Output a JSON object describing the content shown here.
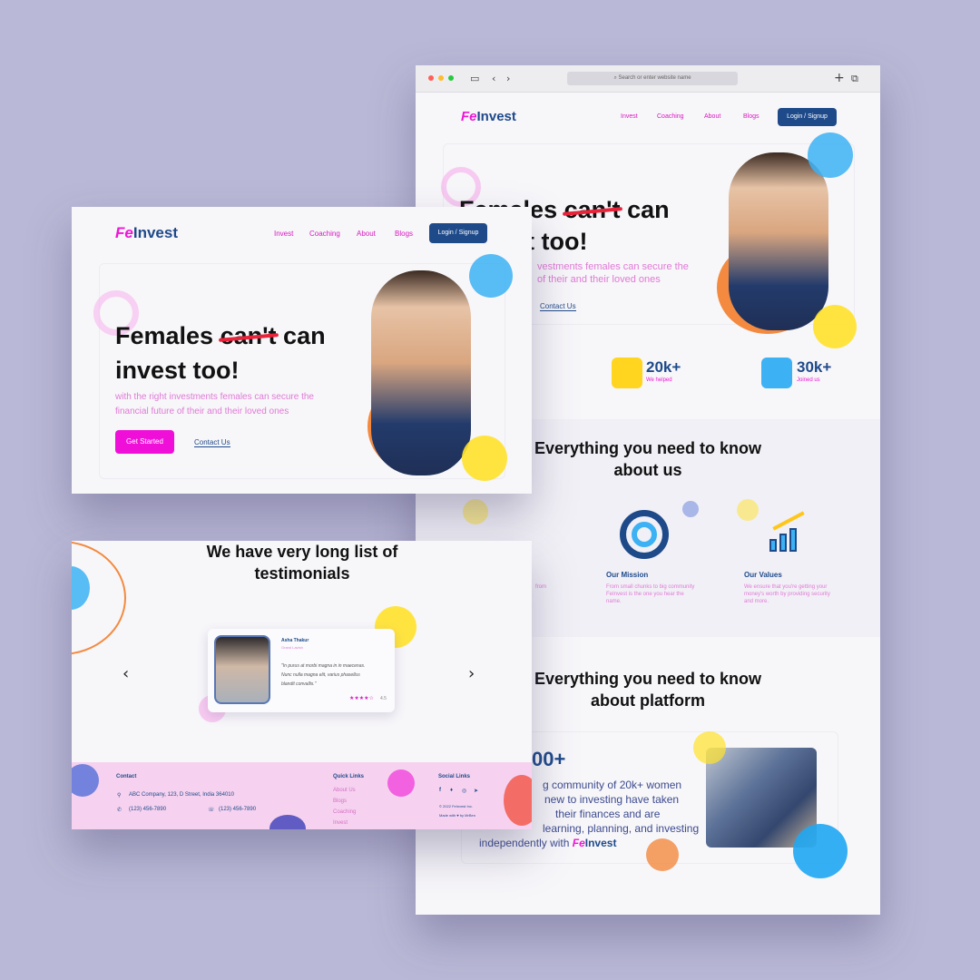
{
  "brand": {
    "fe": "Fe",
    "invest": "Invest"
  },
  "nav": {
    "invest": "Invest",
    "coaching": "Coaching",
    "about": "About",
    "blogs": "Blogs",
    "login": "Login / Signup"
  },
  "browser": {
    "url_placeholder": "Search or enter website name"
  },
  "hero": {
    "title_word1": "Females",
    "title_strike": "can't",
    "title_word3": "can",
    "title_line2": "invest too!",
    "subtitle_line1": "with the right investments females can secure the",
    "subtitle_line2": "financial future of their and their loved ones",
    "cta_primary": "Get Started",
    "cta_secondary": "Contact Us"
  },
  "browser_hero": {
    "title_line1_a": "Fema",
    "title_line1_b": "les",
    "title_strike": "can't",
    "title_word3": "can",
    "title_line2": "t too!",
    "subtitle_line1": "vestments females can secure the",
    "subtitle_line2": "of their and their loved ones"
  },
  "stats": [
    {
      "value": "20k+",
      "label": "We helped"
    },
    {
      "value": "30k+",
      "label": "Joined us"
    }
  ],
  "about": {
    "title_line1": "Everything you need to know",
    "title_line2": "about us",
    "mission_title": "Our Mission",
    "mission_text": "From small chunks to big community FeInvest is the one you hear the name.",
    "values_title": "Our Values",
    "values_text": "We ensure that you're getting your money's worth by providing security and more.",
    "left_text_fragment": "from"
  },
  "platform": {
    "title_line1": "Everything you need to know",
    "title_line2": "about platform",
    "count": "00+",
    "text_line1": "g community of 20k+ women",
    "text_line2": "new to investing have taken",
    "text_line3": "their finances and are",
    "text_line4": "learning, planning, and investing",
    "text_line5": "independently with"
  },
  "testimonials": {
    "title_line1": "We have very long list of",
    "title_line2": "testimonials",
    "name": "Asha Thakur",
    "role": "Grand Lavish",
    "quote_line1": "\"In purus at morbi magna in in maecenas.",
    "quote_line2": "Nunc nulla magna elit, varius phasellus",
    "quote_line3": "blandit convallis.\"",
    "rating": "4.5",
    "stars": "★★★★☆"
  },
  "footer": {
    "contact_heading": "Contact",
    "address": "ABC Company, 123, D Street, India 364010",
    "phone": "(123) 456-7890",
    "phone2": "(123) 456-7890",
    "quick_heading": "Quick Links",
    "links": [
      "About Us",
      "Blogs",
      "Coaching",
      "Invest"
    ],
    "social_heading": "Social Links",
    "copyright": "© 2022 FeInvest Inc.",
    "made_with": "Made with ♥ by MrBen"
  },
  "colors": {
    "brand_pink": "#ef16d6",
    "brand_navy": "#1e4a8a",
    "background": "#b9b8d6"
  }
}
